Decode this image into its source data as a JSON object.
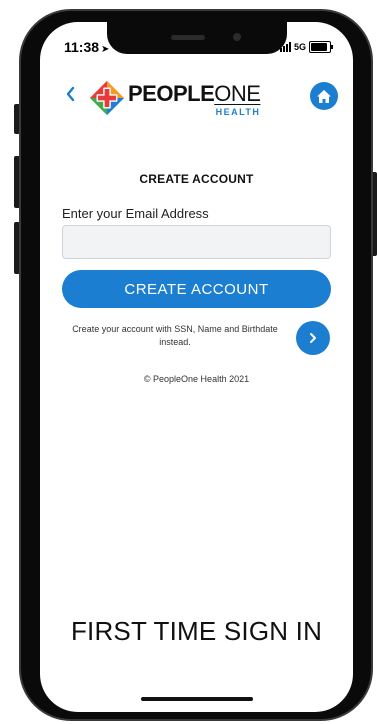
{
  "status_bar": {
    "time": "11:38",
    "location_arrow": "location-arrow-icon",
    "network": "5G",
    "signal_icon": "signal-bars-icon",
    "battery_icon": "battery-icon"
  },
  "header": {
    "back_icon": "chevron-left-icon",
    "logo": {
      "word1": "PEOPLE",
      "word2": "ONE",
      "sub": "HEALTH"
    },
    "home_icon": "home-icon"
  },
  "form": {
    "title": "CREATE ACCOUNT",
    "email_label": "Enter your Email Address",
    "email_value": "",
    "email_placeholder": "",
    "submit_label": "CREATE ACCOUNT"
  },
  "alternate": {
    "text": "Create your account with SSN, Name and Birthdate instead.",
    "arrow_icon": "chevron-right-icon"
  },
  "footer": {
    "copyright": "© PeopleOne Health 2021"
  },
  "caption": "FIRST TIME SIGN IN",
  "colors": {
    "brand_blue": "#1b7ed0",
    "logo_red": "#e83a3a",
    "logo_orange": "#f59a23",
    "logo_green": "#3fae49",
    "logo_blue": "#1e7fd2"
  }
}
